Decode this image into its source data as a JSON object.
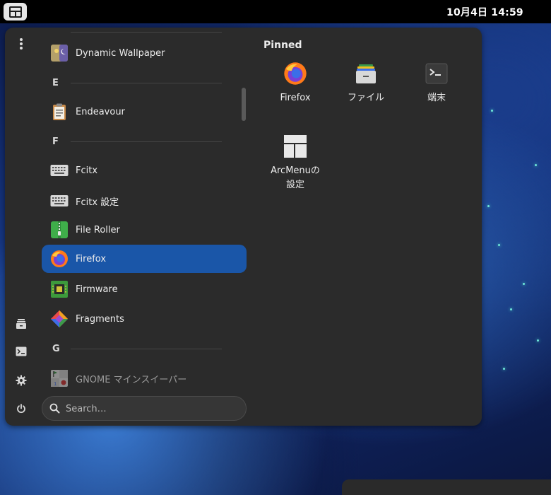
{
  "topbar": {
    "activities_icon": "activities-icon",
    "clock": "10月4日  14:59"
  },
  "rail": {
    "items": [
      {
        "name": "more-options",
        "icon": "kebab-menu-icon"
      },
      {
        "name": "files",
        "icon": "files-icon"
      },
      {
        "name": "terminal",
        "icon": "terminal-icon"
      },
      {
        "name": "settings",
        "icon": "gear-icon"
      },
      {
        "name": "power",
        "icon": "power-icon"
      }
    ]
  },
  "app_list": {
    "items": [
      {
        "type": "app",
        "label": "Dynamic Wallpaper",
        "icon": "dynamic-wallpaper-icon"
      },
      {
        "type": "section",
        "label": "E"
      },
      {
        "type": "app",
        "label": "Endeavour",
        "icon": "clipboard-icon"
      },
      {
        "type": "section",
        "label": "F"
      },
      {
        "type": "app",
        "label": "Fcitx",
        "icon": "keyboard-icon"
      },
      {
        "type": "app",
        "label": "Fcitx 設定",
        "icon": "keyboard-icon"
      },
      {
        "type": "app",
        "label": "File Roller",
        "icon": "archive-icon"
      },
      {
        "type": "app",
        "label": "Firefox",
        "icon": "firefox-icon",
        "active": true
      },
      {
        "type": "app",
        "label": "Firmware",
        "icon": "chip-icon"
      },
      {
        "type": "app",
        "label": "Fragments",
        "icon": "fragments-icon"
      },
      {
        "type": "section",
        "label": "G"
      },
      {
        "type": "app",
        "label": "GNOME マインスイーパー",
        "icon": "minesweeper-icon"
      }
    ]
  },
  "search": {
    "placeholder": "Search…"
  },
  "pinned": {
    "title": "Pinned",
    "items": [
      {
        "label": "Firefox",
        "icon": "firefox-icon"
      },
      {
        "label": "ファイル",
        "icon": "files-icon"
      },
      {
        "label": "端末",
        "icon": "terminal-icon"
      },
      {
        "label": "ArcMenuの設定",
        "icon": "arcmenu-settings-icon"
      }
    ]
  },
  "colors": {
    "accent": "#1a56a8",
    "menu_bg": "#2b2b2b",
    "topbar_bg": "#000000"
  }
}
